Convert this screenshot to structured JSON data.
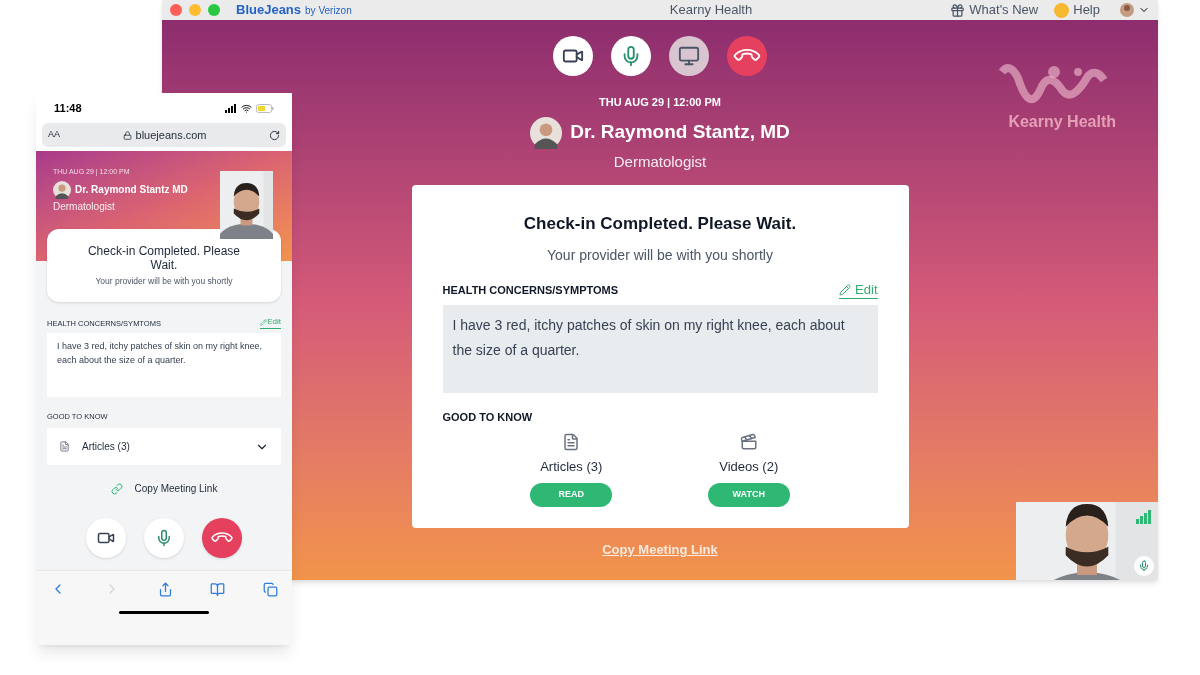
{
  "desktop": {
    "title_bar": {
      "brand": "BlueJeans",
      "brand_suffix": "by Verizon",
      "title": "Kearny Health",
      "whats_new": "What's New",
      "help": "Help"
    },
    "call_controls": [
      {
        "kind": "video"
      },
      {
        "kind": "mic"
      },
      {
        "kind": "screen"
      },
      {
        "kind": "hangup"
      }
    ],
    "logo_text": "Kearny Health",
    "appointment": {
      "datetime": "THU AUG 29 | 12:00 PM",
      "doctor": "Dr. Raymond Stantz, MD",
      "specialty": "Dermatologist"
    },
    "card": {
      "title": "Check-in Completed. Please Wait.",
      "subtitle": "Your provider will be with you shortly",
      "concerns_label": "HEALTH CONCERNS/SYMPTOMS",
      "edit": "Edit",
      "concerns": "I have 3 red, itchy patches of skin on my right knee, each about the size of a quarter.",
      "good_to_know": "GOOD TO KNOW",
      "resources": [
        {
          "kind": "article",
          "label": "Articles (3)",
          "action": "READ"
        },
        {
          "kind": "video",
          "label": "Videos (2)",
          "action": "WATCH"
        }
      ]
    },
    "copy_link": "Copy Meeting Link"
  },
  "phone": {
    "time": "11:48",
    "text_size": "AA",
    "url": "bluejeans.com",
    "appointment": {
      "datetime": "THU AUG 29 | 12:00 PM",
      "doctor": "Dr. Raymond Stantz MD",
      "specialty": "Dermatologist"
    },
    "card": {
      "title": "Check-in Completed. Please Wait.",
      "subtitle": "Your provider will be with you shortly"
    },
    "concerns_label": "HEALTH CONCERNS/SYMTOMS",
    "edit": "Edit",
    "concerns": "I have 3 red, itchy patches of skin on my right knee, each about the size of a quarter.",
    "good_to_know": "GOOD TO KNOW",
    "articles": {
      "label": "Articles (3)",
      "expanded": false
    },
    "copy_link": "Copy Meeting Link",
    "call_controls": [
      {
        "kind": "video"
      },
      {
        "kind": "mic"
      },
      {
        "kind": "hangup"
      }
    ]
  }
}
